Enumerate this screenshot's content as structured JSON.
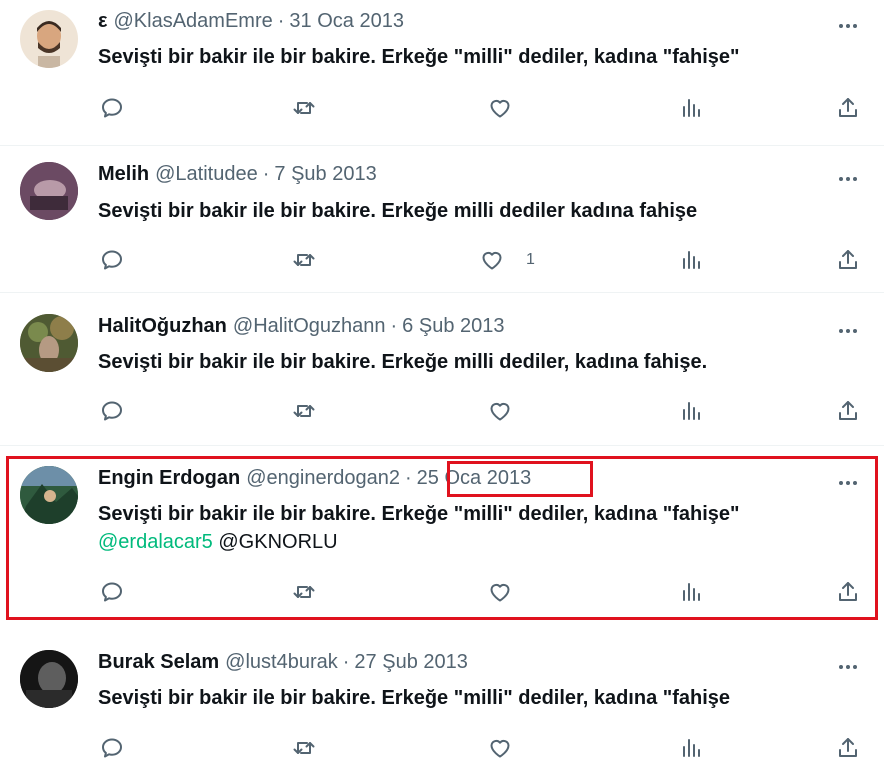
{
  "tweets": [
    {
      "name": "ε",
      "handle": "@KlasAdamEmre",
      "date": "31 Oca 2013",
      "text": "Sevişti bir bakir ile bir bakire. Erkeğe \"milli\" dediler, kadına \"fahişe\"",
      "like_count": "",
      "avatar_color": "#e9dccd"
    },
    {
      "name": "Melih",
      "handle": "@Latitudee",
      "date": "7 Şub 2013",
      "text": "Sevişti bir bakir ile bir bakire. Erkeğe milli dediler kadına fahişe",
      "like_count": "1",
      "avatar_color": "#5a3b55"
    },
    {
      "name": "HalitOğuzhan",
      "handle": "@HalitOguzhann",
      "date": "6 Şub 2013",
      "text": "Sevişti bir bakir ile bir bakire. Erkeğe milli dediler, kadına fahişe.",
      "like_count": "",
      "avatar_color": "#6f6a45"
    },
    {
      "name": "Engin Erdogan",
      "handle": "@enginerdogan2",
      "date": "25 Oca 2013",
      "text": "Sevişti bir bakir ile bir bakire. Erkeğe \"milli\" dediler, kadına \"fahişe\"",
      "mention_link": "@erdalacar5",
      "mention_plain": "@GKNORLU",
      "like_count": "",
      "avatar_color": "#3b6a4a"
    },
    {
      "name": "Burak Selam",
      "handle": "@lust4burak",
      "date": "27 Şub 2013",
      "text": "Sevişti bir bakir ile bir bakire. Erkeğe \"milli\" dediler, kadına \"fahişe",
      "like_count": "",
      "avatar_color": "#1d1d1d"
    }
  ],
  "separator": "·",
  "icons": [
    "reply-icon",
    "retweet-icon",
    "like-icon",
    "views-icon",
    "share-icon",
    "more-icon"
  ],
  "colors": {
    "highlight": "#e0121e",
    "mention": "#00ba7c",
    "secondary_text": "#536471"
  }
}
